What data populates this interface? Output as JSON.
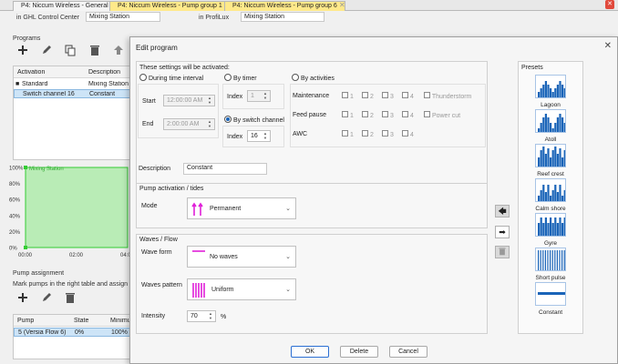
{
  "tabs": [
    {
      "label": "P4: Niccum Wireless - General",
      "active": false
    },
    {
      "label": "P4: Niccum Wireless - Pump group 1",
      "active": true
    },
    {
      "label": "P4: Niccum Wireless - Pump group 6",
      "active": true
    }
  ],
  "background": {
    "ghl_label": "in GHL Control Center",
    "ghl_value": "Mixing Station",
    "profilux_label": "in ProfiLux",
    "profilux_value": "Mixing Station",
    "programs_title": "Programs",
    "programs_table": {
      "headers": [
        "Activation",
        "Description"
      ],
      "rows": [
        {
          "activation": "Standard",
          "description": "Mixing Station",
          "selected": false
        },
        {
          "activation": "Switch channel 16",
          "description": "Constant",
          "selected": true
        }
      ]
    },
    "chart_data": {
      "type": "area",
      "series": [
        {
          "name": "Mixing Station",
          "values": [
            100,
            100,
            100
          ]
        }
      ],
      "x": [
        "00:00",
        "02:00",
        "04:00"
      ],
      "yticks": [
        "100%",
        "80%",
        "60%",
        "40%",
        "20%",
        "0%"
      ],
      "ylim": [
        0,
        100
      ]
    },
    "pump_assignment_title": "Pump assignment",
    "pump_assignment_hint": "Mark pumps in the right table and assign them",
    "pump_table": {
      "headers": [
        "Pump",
        "State",
        "Minimu"
      ],
      "rows": [
        {
          "pump": "5 (Versia Flow 6)",
          "state": "0%",
          "minimum": "100%"
        }
      ]
    }
  },
  "dialog": {
    "title": "Edit program",
    "activation_group_title": "These settings will be activated:",
    "radio_time": "During time interval",
    "radio_timer": "By timer",
    "radio_activities": "By activities",
    "radio_switch": "By switch channel",
    "start_label": "Start",
    "start_value": "12:00:00 AM",
    "end_label": "End",
    "end_value": "2:00:00 AM",
    "index_label": "Index",
    "timer_index_value": "1",
    "switch_index_value": "16",
    "activities": [
      {
        "label": "Maintenance",
        "extra": "Thunderstorm"
      },
      {
        "label": "Feed pause",
        "extra": "Power cut"
      },
      {
        "label": "AWC",
        "extra": ""
      }
    ],
    "activity_nums": [
      "1",
      "2",
      "3",
      "4"
    ],
    "description_label": "Description",
    "description_value": "Constant",
    "pump_group_title": "Pump activation / tides",
    "mode_label": "Mode",
    "mode_value": "Permanent",
    "waves_group_title": "Waves / Flow",
    "waveform_label": "Wave form",
    "waveform_value": "No waves",
    "wavepattern_label": "Waves pattern",
    "wavepattern_value": "Uniform",
    "intensity_label": "Intensity",
    "intensity_value": "70",
    "intensity_unit": "%",
    "ok_label": "OK",
    "delete_label": "Delete",
    "cancel_label": "Cancel",
    "presets_title": "Presets",
    "presets": [
      {
        "label": "Lagoon"
      },
      {
        "label": "Atoll"
      },
      {
        "label": "Reef crest"
      },
      {
        "label": "Calm shore"
      },
      {
        "label": "Gyre"
      },
      {
        "label": "Short pulse"
      },
      {
        "label": "Constant"
      }
    ]
  },
  "colors": {
    "accent": "#1a64b8",
    "chart_fill": "#b9ecb6",
    "chart_line": "#33cc33",
    "magenta": "#e020d8",
    "tab_active": "#ffe98a"
  }
}
